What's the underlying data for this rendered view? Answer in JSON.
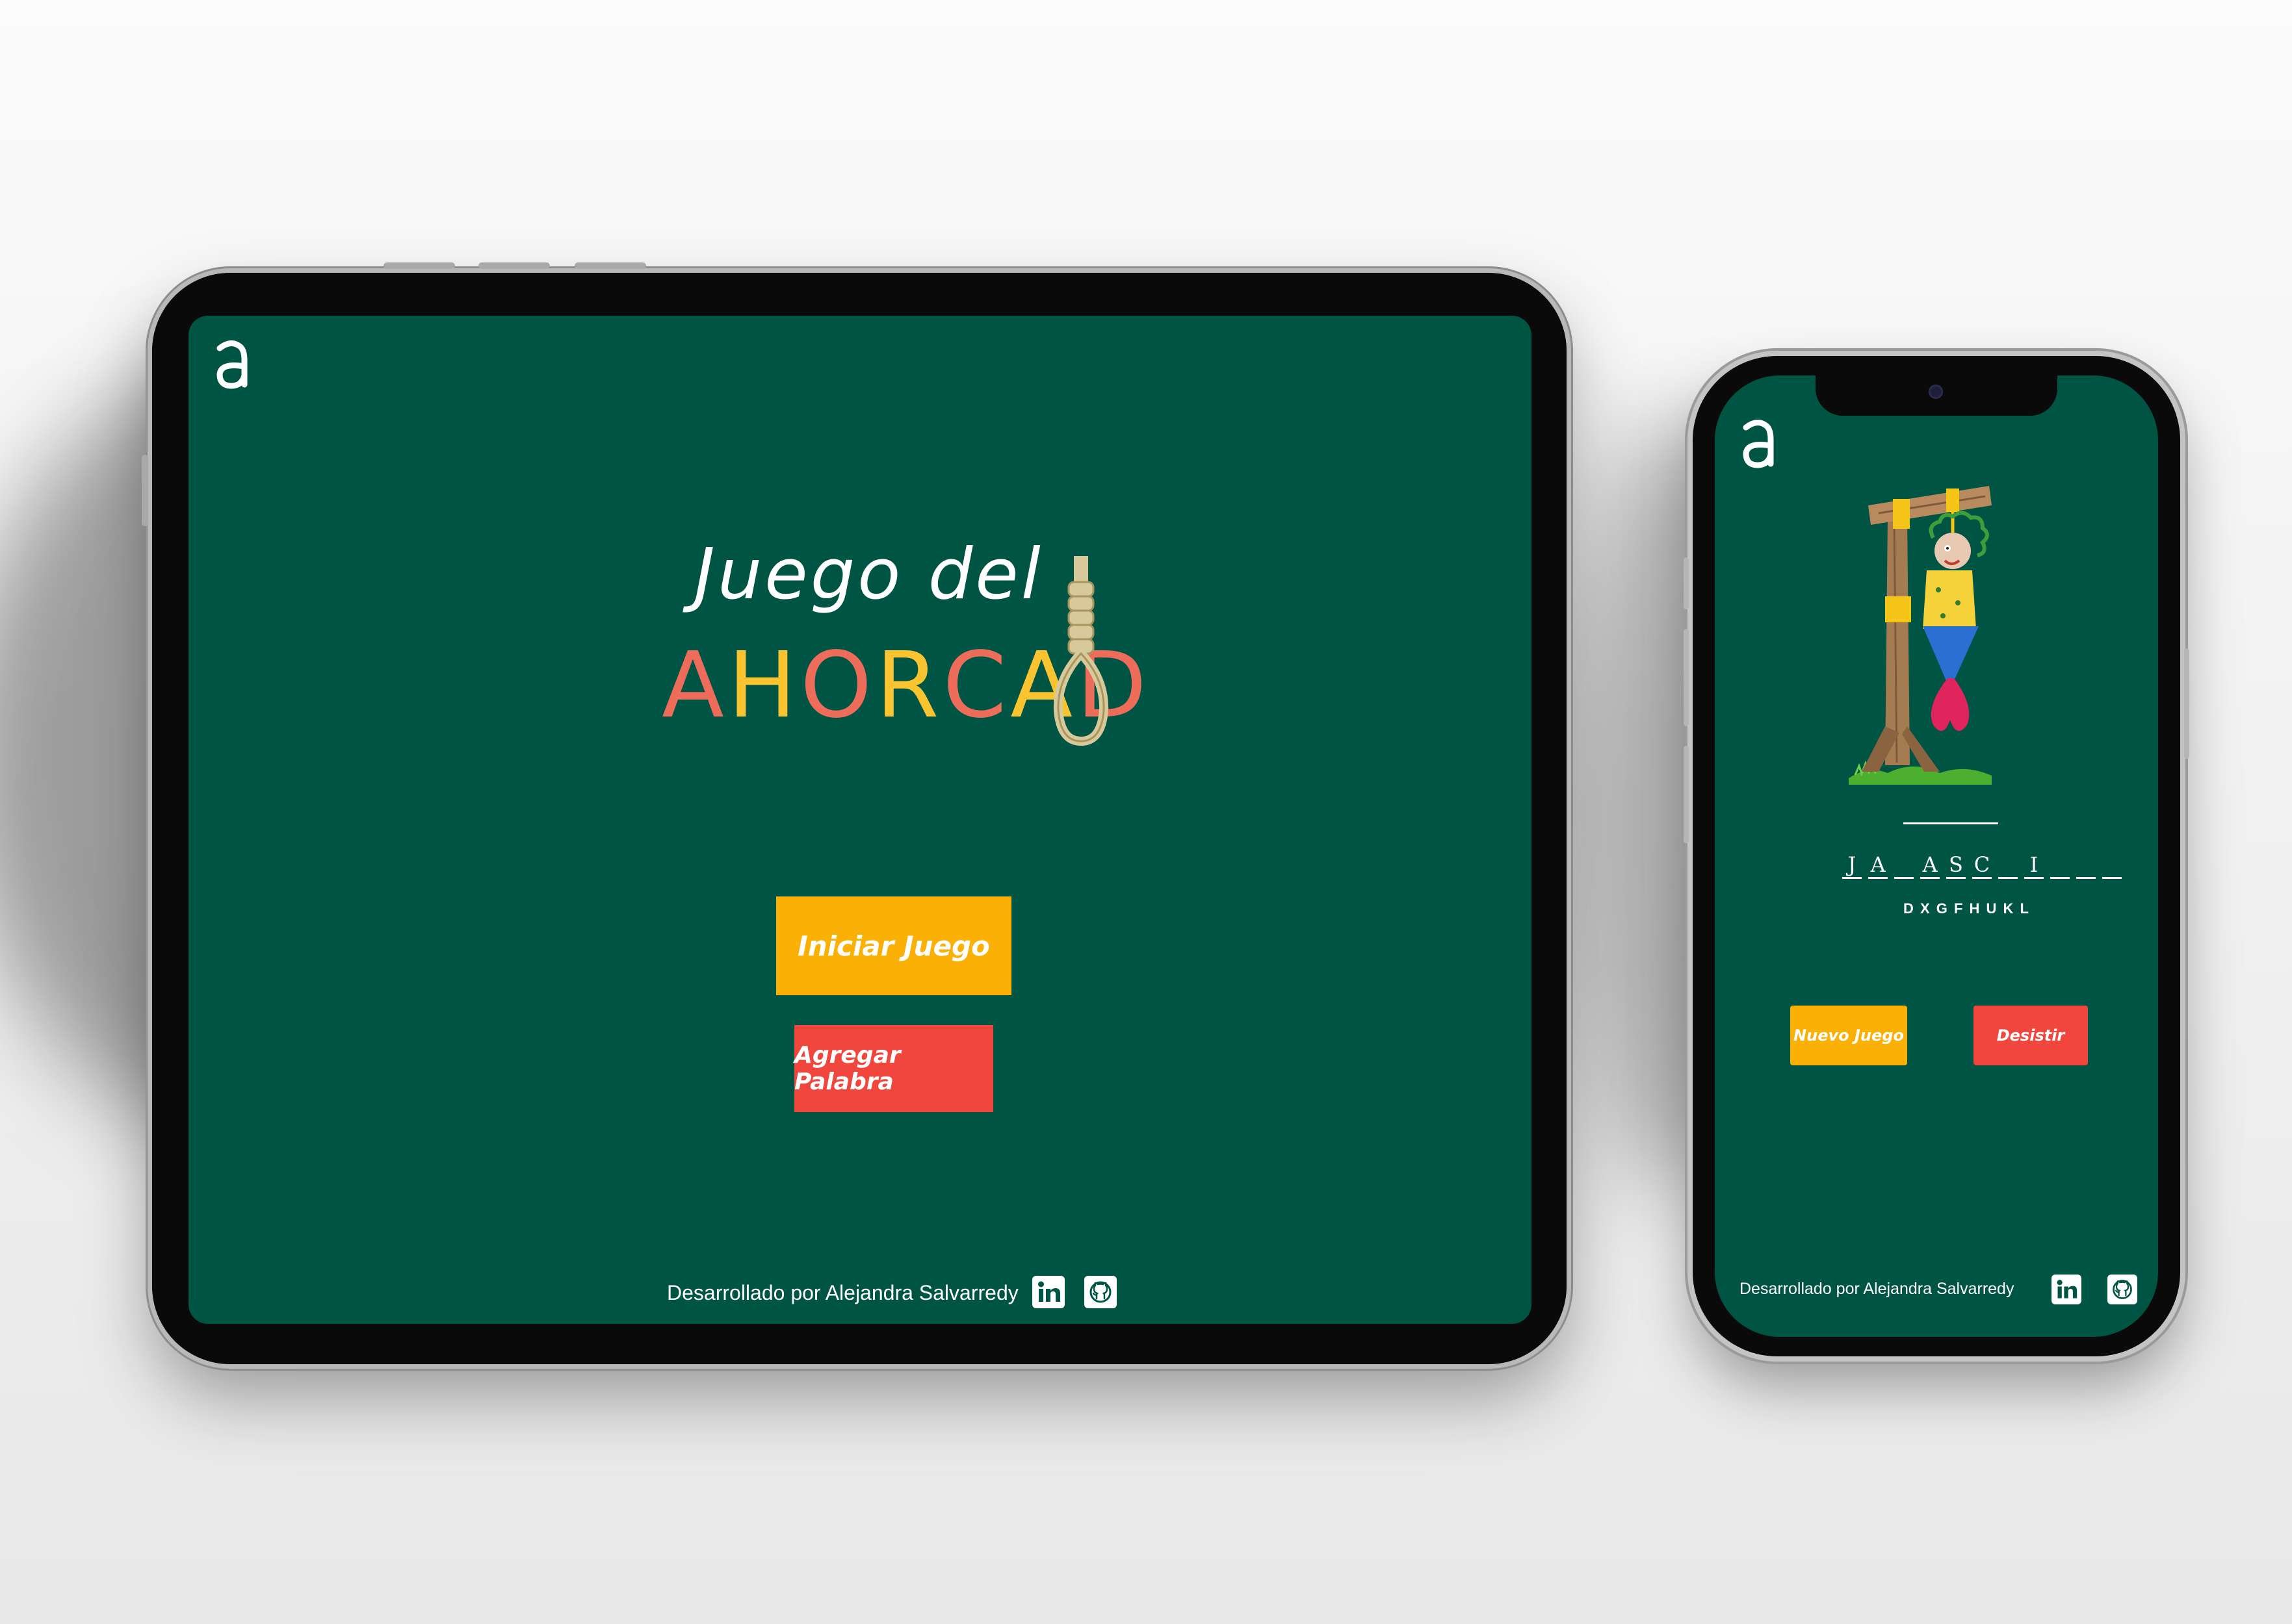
{
  "colors": {
    "screen_bg": "#005444",
    "accent_yellow": "#FAB005",
    "accent_red": "#F0463D",
    "ahorcado_letters": [
      "#EE6D5A",
      "#F9C430",
      "#EE6D5A",
      "#F9C430",
      "#EE6D5A",
      "#F9C430",
      "#EE6D5A",
      "#F9C430"
    ]
  },
  "tablet": {
    "logo_letter": "a",
    "title": {
      "line1": "Juego del",
      "line2_letters": [
        "A",
        "H",
        "O",
        "R",
        "C",
        "A",
        "D"
      ]
    },
    "buttons": {
      "start_label": "Iniciar Juego",
      "add_word_label": "Agregar Palabra"
    },
    "footer": {
      "credit": "Desarrollado por Alejandra Salvarredy",
      "linkedin_icon": "linkedin-icon",
      "github_icon": "github-icon"
    }
  },
  "phone": {
    "logo_letter": "a",
    "word_slots": [
      "J",
      "A",
      "",
      "A",
      "S",
      "C",
      "",
      "I",
      "",
      "",
      ""
    ],
    "wrong_letters": "D X G F H U K L",
    "buttons": {
      "new_game_label": "Nuevo Juego",
      "quit_label": "Desistir"
    },
    "footer": {
      "credit": "Desarrollado por Alejandra Salvarredy",
      "linkedin_icon": "linkedin-icon",
      "github_icon": "github-icon"
    }
  }
}
